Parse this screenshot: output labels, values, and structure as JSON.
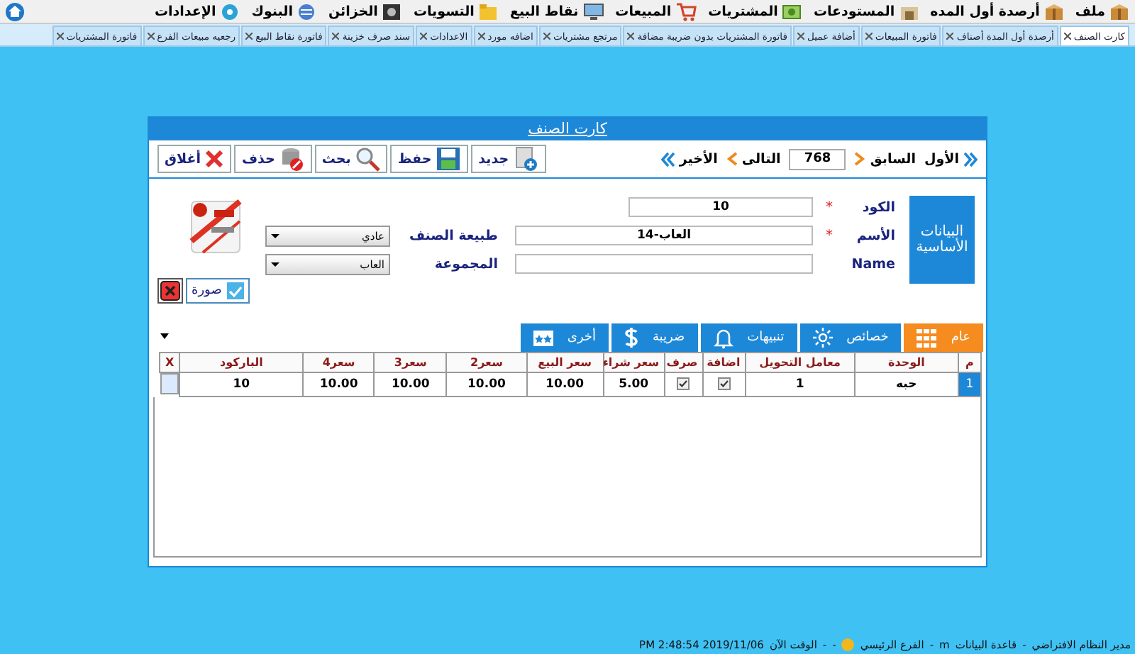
{
  "menu": [
    {
      "label": "ملف",
      "kind": "box"
    },
    {
      "label": "أرصدة أول المده",
      "kind": "box"
    },
    {
      "label": "المستودعات",
      "kind": "store"
    },
    {
      "label": "المشتريات",
      "kind": "money"
    },
    {
      "label": "المبيعات",
      "kind": "cart"
    },
    {
      "label": "نقاط البيع",
      "kind": "screen"
    },
    {
      "label": "التسويات",
      "kind": "folder"
    },
    {
      "label": "الخزائن",
      "kind": "safe"
    },
    {
      "label": "البنوك",
      "kind": "bank"
    },
    {
      "label": "الإعدادات",
      "kind": "gear"
    }
  ],
  "tabs": [
    {
      "label": "كارت الصنف",
      "selected": true
    },
    {
      "label": "أرصدة أول المدة أصناف",
      "selected": false
    },
    {
      "label": "فاتورة المبيعات",
      "selected": false
    },
    {
      "label": "أضافة عميل",
      "selected": false
    },
    {
      "label": "فاتورة المشتريات بدون ضريبة مضافة",
      "selected": false
    },
    {
      "label": "مرتجع مشتريات",
      "selected": false
    },
    {
      "label": "اضافه مورد",
      "selected": false
    },
    {
      "label": "الاعدادات",
      "selected": false
    },
    {
      "label": "سند صرف خزينة",
      "selected": false
    },
    {
      "label": "فاتورة نقاط البيع",
      "selected": false
    },
    {
      "label": "رجعيه مبيعات الفرع",
      "selected": false
    },
    {
      "label": "فاتورة المشتريات",
      "selected": false
    }
  ],
  "dialog": {
    "title": "كارت الصنف",
    "nav": {
      "first": "الأول",
      "previous": "السابق",
      "record": "768",
      "next": "التالى",
      "last": "الأخير"
    },
    "actions": [
      {
        "label": "جديد",
        "kind": "new"
      },
      {
        "label": "حفظ",
        "kind": "save"
      },
      {
        "label": "بحث",
        "kind": "search"
      },
      {
        "label": "حذف",
        "kind": "delete"
      },
      {
        "label": "أغلاق",
        "kind": "close"
      }
    ],
    "section": "البيانات الأساسية",
    "fields": [
      {
        "label": "الكود",
        "value": "10",
        "mark": "*"
      },
      {
        "label": "الأسم",
        "value": "العاب-14",
        "mark": "*"
      },
      {
        "label": "Name"
      }
    ],
    "selects": [
      {
        "label": "طبيعة الصنف",
        "value": "عادي"
      },
      {
        "label": "المجموعة",
        "value": "العاب"
      }
    ],
    "image_button": {
      "label": "صورة",
      "checked": true
    },
    "subtabs": [
      {
        "label": "عام",
        "kind": "grid",
        "selected": true
      },
      {
        "label": "خصائص",
        "kind": "sun",
        "selected": false
      },
      {
        "label": "تنبيهات",
        "kind": "bell",
        "selected": false
      },
      {
        "label": "ضريبة",
        "kind": "dollar",
        "selected": false
      },
      {
        "label": "أخرى",
        "kind": "ticket",
        "selected": false
      }
    ],
    "table": {
      "columns": [
        "م",
        "الوحدة",
        "معامل التحويل",
        "اضافة",
        "صرف",
        "سعر شراء",
        "سعر البيع",
        "سعر2",
        "سعر3",
        "سعر4",
        "الباركود",
        "X"
      ],
      "rows": [
        {
          "index": "1",
          "unit": "حبه",
          "factor": "1",
          "add": true,
          "out": true,
          "buy": "5.00",
          "sell": "10.00",
          "price2": "10.00",
          "price3": "10.00",
          "price4": "10.00",
          "barcode": "10",
          "selected": true
        }
      ]
    }
  },
  "status_bar": [
    {
      "kind": "text",
      "text": "مدير النظام الافتراضي"
    },
    {
      "kind": "text",
      "text": "-"
    },
    {
      "kind": "text",
      "text": "قاعدة البيانات"
    },
    {
      "kind": "text",
      "text": "m"
    },
    {
      "kind": "text",
      "text": "-"
    },
    {
      "kind": "text",
      "text": "الفرع الرئيسي"
    },
    {
      "kind": "avatar"
    },
    {
      "kind": "text",
      "text": "-"
    },
    {
      "kind": "text",
      "text": "-"
    },
    {
      "kind": "text",
      "text": "الوقت الآن"
    },
    {
      "kind": "text",
      "text": "PM 2:48:54 2019/11/06"
    }
  ]
}
